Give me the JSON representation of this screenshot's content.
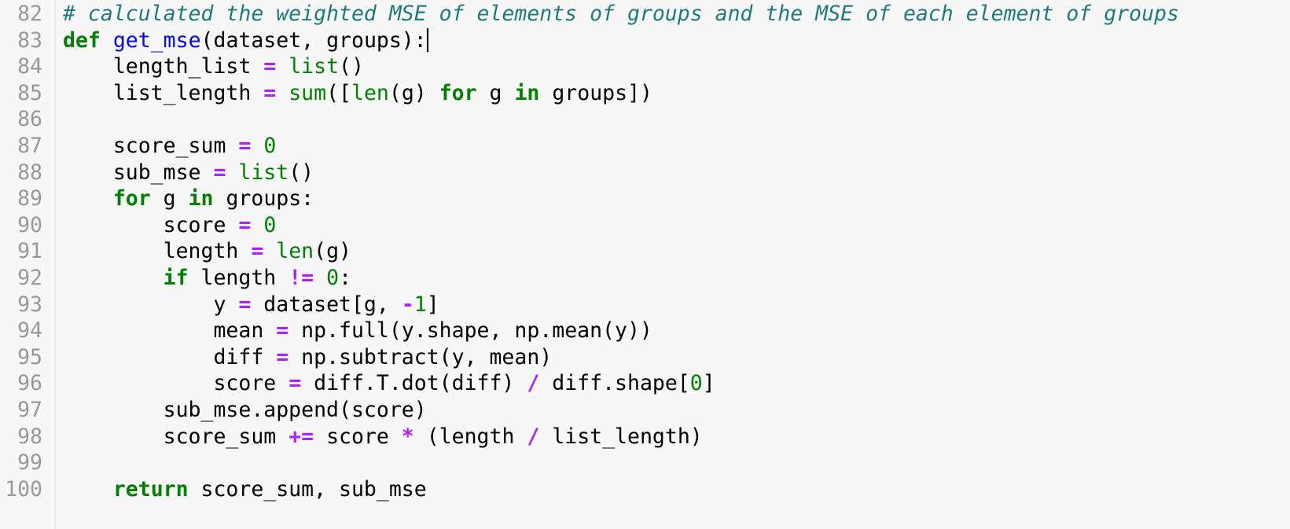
{
  "editor": {
    "colors": {
      "background": "#f7f7f7",
      "line_number": "#999999",
      "comment": "#1f7a7a",
      "keyword": "#008000",
      "function_name": "#0000ff",
      "builtin": "#008000",
      "operator": "#aa22ff",
      "number": "#008000",
      "text": "#000000"
    },
    "cursor_line": 83,
    "lines": [
      {
        "n": "82",
        "tokens": [
          [
            "comment",
            "# calculated the weighted MSE of elements of groups and the MSE of each element of groups"
          ]
        ]
      },
      {
        "n": "83",
        "tokens": [
          [
            "kw",
            "def"
          ],
          [
            "text",
            " "
          ],
          [
            "def",
            "get_mse"
          ],
          [
            "text",
            "(dataset, groups):"
          ]
        ]
      },
      {
        "n": "84",
        "tokens": [
          [
            "text",
            "    length_list "
          ],
          [
            "op",
            "="
          ],
          [
            "text",
            " "
          ],
          [
            "builtin",
            "list"
          ],
          [
            "text",
            "()"
          ]
        ]
      },
      {
        "n": "85",
        "tokens": [
          [
            "text",
            "    list_length "
          ],
          [
            "op",
            "="
          ],
          [
            "text",
            " "
          ],
          [
            "builtin",
            "sum"
          ],
          [
            "text",
            "(["
          ],
          [
            "builtin",
            "len"
          ],
          [
            "text",
            "(g) "
          ],
          [
            "kw",
            "for"
          ],
          [
            "text",
            " g "
          ],
          [
            "kw",
            "in"
          ],
          [
            "text",
            " groups])"
          ]
        ]
      },
      {
        "n": "86",
        "tokens": []
      },
      {
        "n": "87",
        "tokens": [
          [
            "text",
            "    score_sum "
          ],
          [
            "op",
            "="
          ],
          [
            "text",
            " "
          ],
          [
            "num",
            "0"
          ]
        ]
      },
      {
        "n": "88",
        "tokens": [
          [
            "text",
            "    sub_mse "
          ],
          [
            "op",
            "="
          ],
          [
            "text",
            " "
          ],
          [
            "builtin",
            "list"
          ],
          [
            "text",
            "()"
          ]
        ]
      },
      {
        "n": "89",
        "tokens": [
          [
            "text",
            "    "
          ],
          [
            "kw",
            "for"
          ],
          [
            "text",
            " g "
          ],
          [
            "kw",
            "in"
          ],
          [
            "text",
            " groups:"
          ]
        ]
      },
      {
        "n": "90",
        "tokens": [
          [
            "text",
            "        score "
          ],
          [
            "op",
            "="
          ],
          [
            "text",
            " "
          ],
          [
            "num",
            "0"
          ]
        ]
      },
      {
        "n": "91",
        "tokens": [
          [
            "text",
            "        length "
          ],
          [
            "op",
            "="
          ],
          [
            "text",
            " "
          ],
          [
            "builtin",
            "len"
          ],
          [
            "text",
            "(g)"
          ]
        ]
      },
      {
        "n": "92",
        "tokens": [
          [
            "text",
            "        "
          ],
          [
            "kw",
            "if"
          ],
          [
            "text",
            " length "
          ],
          [
            "op",
            "!="
          ],
          [
            "text",
            " "
          ],
          [
            "num",
            "0"
          ],
          [
            "text",
            ":"
          ]
        ]
      },
      {
        "n": "93",
        "tokens": [
          [
            "text",
            "            y "
          ],
          [
            "op",
            "="
          ],
          [
            "text",
            " dataset[g, "
          ],
          [
            "op",
            "-"
          ],
          [
            "num",
            "1"
          ],
          [
            "text",
            "]"
          ]
        ]
      },
      {
        "n": "94",
        "tokens": [
          [
            "text",
            "            mean "
          ],
          [
            "op",
            "="
          ],
          [
            "text",
            " np.full(y.shape, np.mean(y))"
          ]
        ]
      },
      {
        "n": "95",
        "tokens": [
          [
            "text",
            "            diff "
          ],
          [
            "op",
            "="
          ],
          [
            "text",
            " np.subtract(y, mean)"
          ]
        ]
      },
      {
        "n": "96",
        "tokens": [
          [
            "text",
            "            score "
          ],
          [
            "op",
            "="
          ],
          [
            "text",
            " diff.T.dot(diff) "
          ],
          [
            "op",
            "/"
          ],
          [
            "text",
            " diff.shape["
          ],
          [
            "num",
            "0"
          ],
          [
            "text",
            "]"
          ]
        ]
      },
      {
        "n": "97",
        "tokens": [
          [
            "text",
            "        sub_mse.append(score)"
          ]
        ]
      },
      {
        "n": "98",
        "tokens": [
          [
            "text",
            "        score_sum "
          ],
          [
            "op",
            "+="
          ],
          [
            "text",
            " score "
          ],
          [
            "op",
            "*"
          ],
          [
            "text",
            " (length "
          ],
          [
            "op",
            "/"
          ],
          [
            "text",
            " list_length)"
          ]
        ]
      },
      {
        "n": "99",
        "tokens": []
      },
      {
        "n": "100",
        "tokens": [
          [
            "text",
            "    "
          ],
          [
            "kw",
            "return"
          ],
          [
            "text",
            " score_sum, sub_mse"
          ]
        ]
      }
    ]
  }
}
